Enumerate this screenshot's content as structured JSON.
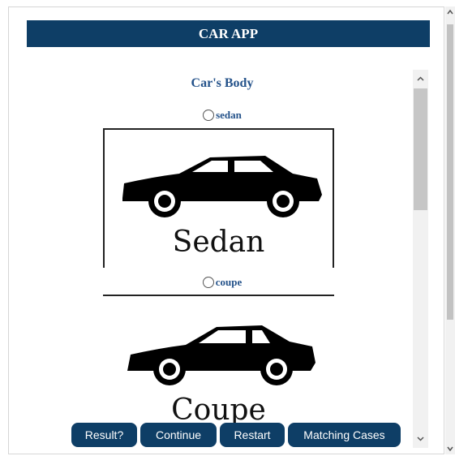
{
  "app": {
    "title": "CAR APP"
  },
  "section": {
    "title": "Car's Body"
  },
  "options": [
    {
      "label": "sedan",
      "caption": "Sedan"
    },
    {
      "label": "coupe",
      "caption": "Coupe"
    }
  ],
  "buttons": {
    "result": "Result?",
    "continue": "Continue",
    "restart": "Restart",
    "matching": "Matching Cases"
  },
  "colors": {
    "header_bg": "#0e3e66",
    "link_text": "#24528a",
    "button_bg": "#0e3e66"
  }
}
